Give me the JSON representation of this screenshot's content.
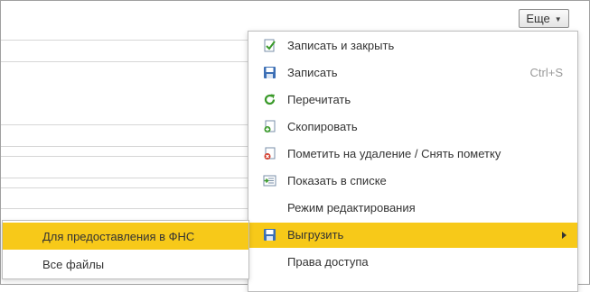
{
  "more_button": {
    "label": "Еще"
  },
  "menu": {
    "items": [
      {
        "label": "Записать и закрыть",
        "icon": "save-and-close-icon",
        "shortcut": ""
      },
      {
        "label": "Записать",
        "icon": "floppy-disk-icon",
        "shortcut": "Ctrl+S"
      },
      {
        "label": "Перечитать",
        "icon": "refresh-icon",
        "shortcut": ""
      },
      {
        "label": "Скопировать",
        "icon": "copy-icon",
        "shortcut": ""
      },
      {
        "label": "Пометить на удаление / Снять пометку",
        "icon": "delete-mark-icon",
        "shortcut": ""
      },
      {
        "label": "Показать в списке",
        "icon": "show-in-list-icon",
        "shortcut": ""
      },
      {
        "label": "Режим редактирования",
        "icon": "",
        "shortcut": ""
      },
      {
        "label": "Выгрузить",
        "icon": "export-disk-icon",
        "shortcut": "",
        "active": true,
        "has_submenu": true
      },
      {
        "label": "Права доступа",
        "icon": "",
        "shortcut": ""
      }
    ]
  },
  "submenu": {
    "items": [
      {
        "label": "Для предоставления в ФНС",
        "active": true
      },
      {
        "label": "Все файлы"
      }
    ]
  },
  "colors": {
    "highlight": "#f7c919",
    "icon_green": "#3a9a2a",
    "icon_blue": "#3c6fb5",
    "icon_red": "#d23a2a"
  }
}
